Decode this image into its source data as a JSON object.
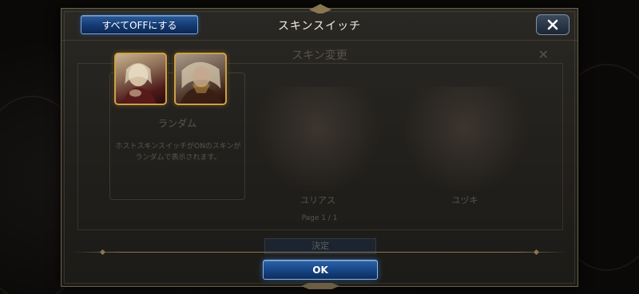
{
  "header": {
    "title": "スキンスイッチ",
    "all_off_label": "すべてOFFにする",
    "close_icon": "close-icon"
  },
  "background_screen": {
    "title": "スキン変更",
    "random_label": "ランダム",
    "random_desc": "ホストスキンスイッチがONのスキンがランダムで表示されます。",
    "characters": [
      "ユリアス",
      "ユヅキ"
    ],
    "page_indicator": "Page 1 / 1",
    "button_label": "決定"
  },
  "thumbnails": [
    {
      "icon": "character-portrait-icon"
    },
    {
      "icon": "character-portrait-icon"
    }
  ],
  "footer": {
    "ok_label": "OK"
  },
  "colors": {
    "accent_blue": "#164484",
    "gold_border": "#c9a24a",
    "panel_bg": "#22201d"
  }
}
